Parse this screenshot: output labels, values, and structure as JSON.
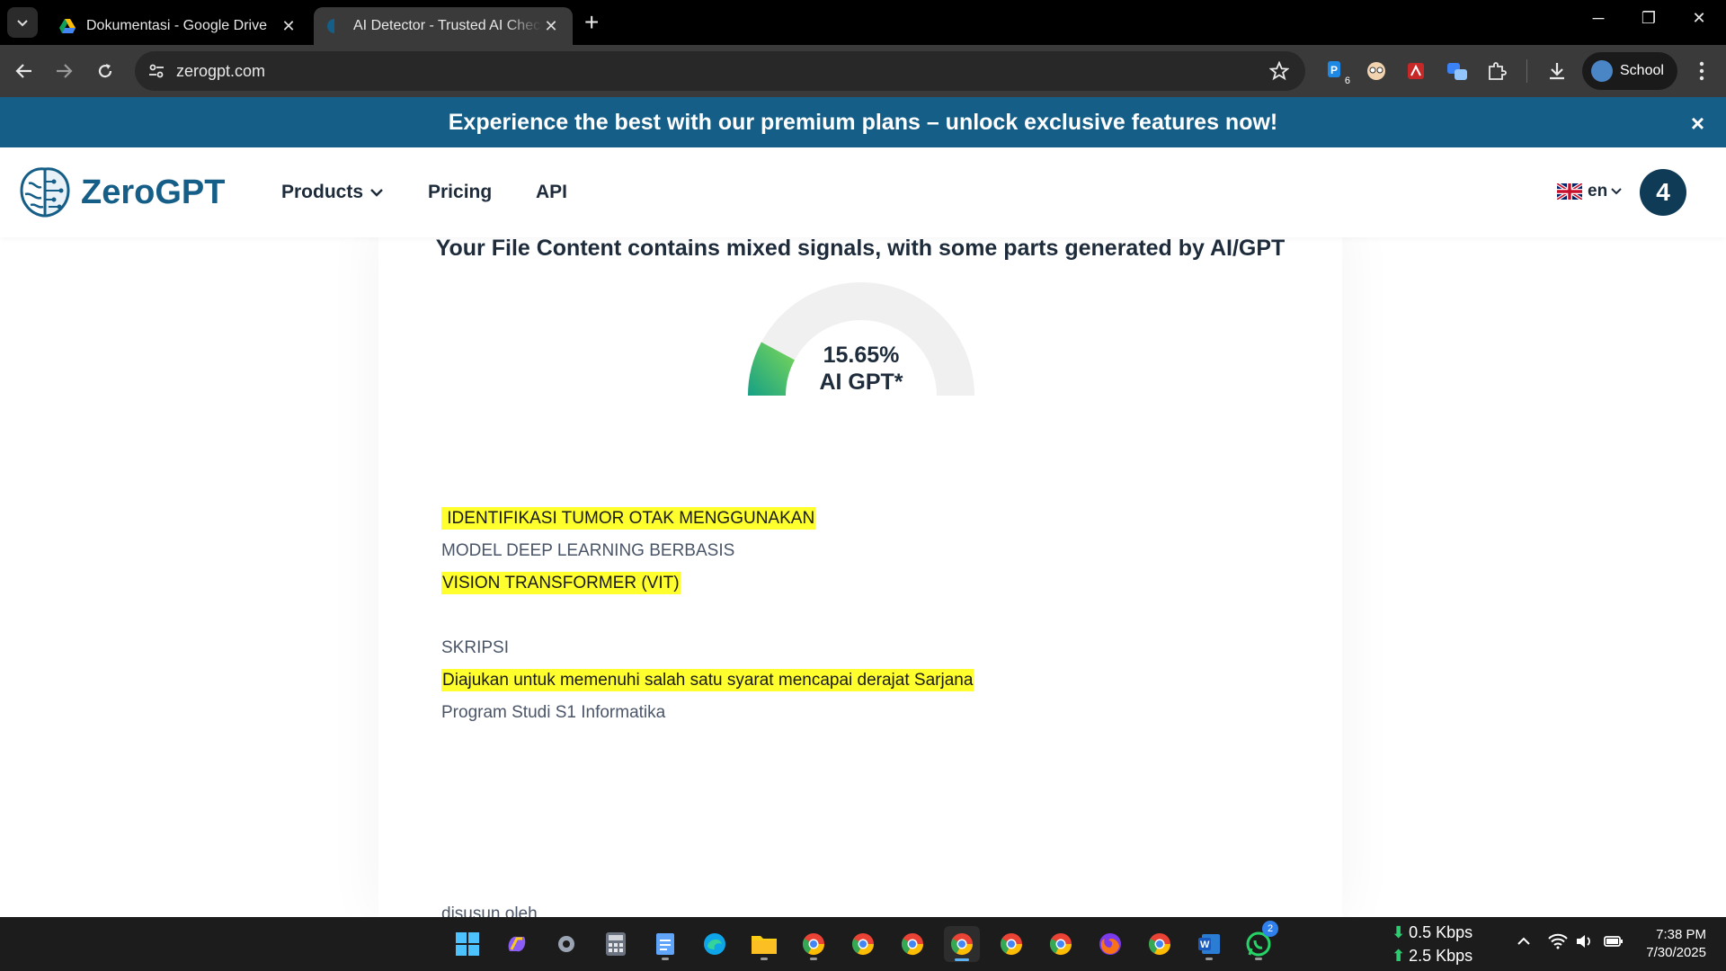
{
  "browser": {
    "tabs": [
      {
        "title": "Dokumentasi - Google Drive",
        "active": false
      },
      {
        "title": "AI Detector - Trusted AI Checker",
        "active": true
      }
    ],
    "url": "zerogpt.com",
    "profile_label": "School",
    "extension_badge": "6"
  },
  "promo": {
    "text": "Experience the best with our premium plans – unlock exclusive features now!",
    "close": "×"
  },
  "site": {
    "logo_text": "ZeroGPT",
    "nav": {
      "products": "Products",
      "pricing": "Pricing",
      "api": "API"
    },
    "language": "en",
    "user_badge": "4"
  },
  "result": {
    "title": "Your File Content contains mixed signals, with some parts generated by AI/GPT",
    "percent_text": "15.65%",
    "percent_value": 15.65,
    "label": "AI GPT*",
    "colors": {
      "gauge_start": "#16a085",
      "gauge_end": "#7ed957",
      "track": "#f0f0f0"
    }
  },
  "document": {
    "lines": [
      {
        "text": " IDENTIFIKASI TUMOR OTAK MENGGUNAKAN",
        "highlight": true
      },
      {
        "text": "MODEL DEEP LEARNING BERBASIS",
        "highlight": false
      },
      {
        "text": "VISION TRANSFORMER (VIT)",
        "highlight": true
      },
      {
        "text": "SKRIPSI",
        "highlight": false
      },
      {
        "text": "Diajukan untuk memenuhi salah satu syarat mencapai derajat Sarjana",
        "highlight": true
      },
      {
        "text": "Program Studi S1 Informatika",
        "highlight": false
      },
      {
        "text": "disusun oleh",
        "highlight": false
      }
    ]
  },
  "taskbar": {
    "net_down": "0.5 Kbps",
    "net_up": "2.5 Kbps",
    "time": "7:38 PM",
    "date": "7/30/2025",
    "whatsapp_badge": "2"
  }
}
